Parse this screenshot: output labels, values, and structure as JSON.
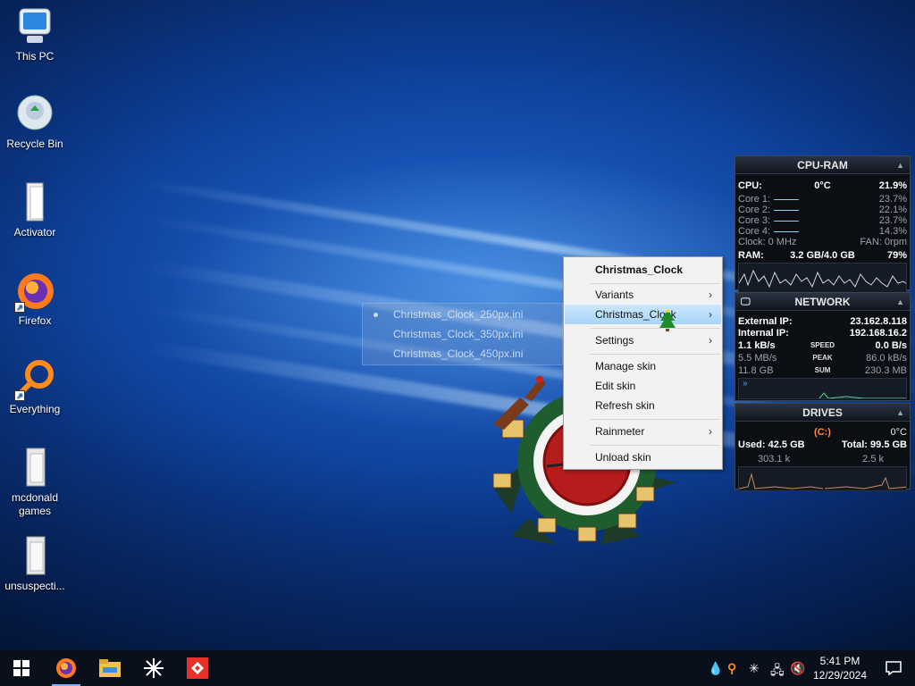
{
  "desktop": {
    "icons": [
      {
        "label": "This PC"
      },
      {
        "label": "Recycle Bin"
      },
      {
        "label": "Activator"
      },
      {
        "label": "Firefox"
      },
      {
        "label": "Everything"
      },
      {
        "label": "mcdonald games"
      },
      {
        "label": "unsuspecti..."
      }
    ]
  },
  "ghost_menu": {
    "items": [
      "Christmas_Clock_250px.ini",
      "Christmas_Clock_350px.ini",
      "Christmas_Clock_450px.ini"
    ]
  },
  "context_menu": {
    "title": "Christmas_Clock",
    "variants": "Variants",
    "selected": "Christmas_Clock",
    "settings": "Settings",
    "manage": "Manage skin",
    "edit": "Edit skin",
    "refresh": "Refresh skin",
    "rainmeter": "Rainmeter",
    "unload": "Unload skin",
    "arrow": "›"
  },
  "cpu_ram": {
    "title": "CPU-RAM",
    "cpu_label": "CPU:",
    "temp": "0°C",
    "cpu_pct": "21.9%",
    "cores": [
      {
        "label": "Core 1:",
        "value": "23.7%"
      },
      {
        "label": "Core 2:",
        "value": "22.1%"
      },
      {
        "label": "Core 3:",
        "value": "23.7%"
      },
      {
        "label": "Core 4:",
        "value": "14.3%"
      }
    ],
    "clock": "Clock: 0 MHz",
    "fan": "FAN: 0rpm",
    "ram_label": "RAM:",
    "ram_value": "3.2 GB/4.0 GB",
    "ram_pct": "79%"
  },
  "network": {
    "title": "NETWORK",
    "ext_label": "External IP:",
    "ext_ip": "23.162.8.118",
    "int_label": "Internal IP:",
    "int_ip": "192.168.16.2",
    "down": "1.1 kB/s",
    "speed_label": "SPEED",
    "up": "0.0 B/s",
    "peak_down": "5.5 MB/s",
    "peak_label": "PEAK",
    "peak_up": "86.0 kB/s",
    "sum_down": "11.8 GB",
    "sum_label": "SUM",
    "sum_up": "230.3 MB"
  },
  "drives": {
    "title": "DRIVES",
    "drive": "(C:)",
    "temp": "0°C",
    "used": "Used: 42.5 GB",
    "total": "Total: 99.5 GB",
    "read": "303.1 k",
    "write": "2.5 k"
  },
  "taskbar": {
    "time": "5:41 PM",
    "date": "12/29/2024"
  },
  "colors": {
    "accent": "#91c9f7",
    "tree": "#1f8a2c",
    "drive_orange": "#ff8a3a"
  }
}
